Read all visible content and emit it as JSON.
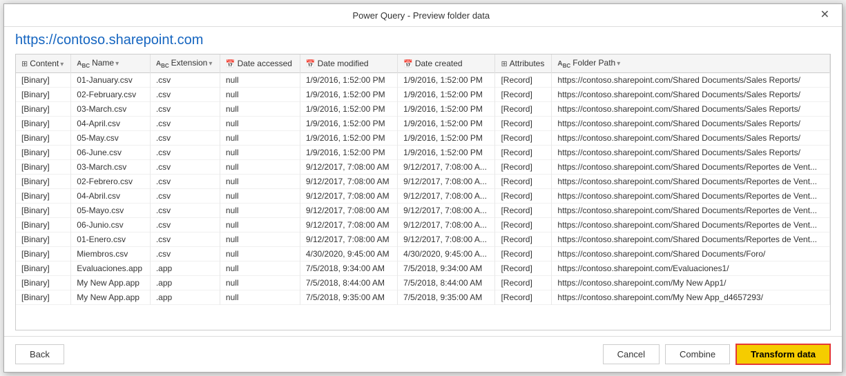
{
  "dialog": {
    "title": "Power Query - Preview folder data",
    "url": "https://contoso.sharepoint.com",
    "close_label": "✕"
  },
  "footer": {
    "back_label": "Back",
    "cancel_label": "Cancel",
    "combine_label": "Combine",
    "transform_label": "Transform data"
  },
  "table": {
    "columns": [
      {
        "id": "content",
        "icon": "≡",
        "filter": true,
        "label": "Content"
      },
      {
        "id": "name",
        "icon": "ABC",
        "filter": true,
        "label": "Name"
      },
      {
        "id": "extension",
        "icon": "ABC",
        "filter": true,
        "label": "Extension"
      },
      {
        "id": "date_accessed",
        "icon": "🗓",
        "filter": false,
        "label": "Date accessed"
      },
      {
        "id": "date_modified",
        "icon": "🗓",
        "filter": false,
        "label": "Date modified"
      },
      {
        "id": "date_created",
        "icon": "🗓",
        "filter": false,
        "label": "Date created"
      },
      {
        "id": "attributes",
        "icon": "≡",
        "filter": false,
        "label": "Attributes"
      },
      {
        "id": "folder_path",
        "icon": "ABC",
        "filter": true,
        "label": "Folder Path"
      }
    ],
    "rows": [
      {
        "content": "[Binary]",
        "name": "01-January.csv",
        "extension": ".csv",
        "date_accessed": "null",
        "date_modified": "1/9/2016, 1:52:00 PM",
        "date_created": "1/9/2016, 1:52:00 PM",
        "attributes": "[Record]",
        "folder_path": "https://contoso.sharepoint.com/Shared Documents/Sales Reports/"
      },
      {
        "content": "[Binary]",
        "name": "02-February.csv",
        "extension": ".csv",
        "date_accessed": "null",
        "date_modified": "1/9/2016, 1:52:00 PM",
        "date_created": "1/9/2016, 1:52:00 PM",
        "attributes": "[Record]",
        "folder_path": "https://contoso.sharepoint.com/Shared Documents/Sales Reports/"
      },
      {
        "content": "[Binary]",
        "name": "03-March.csv",
        "extension": ".csv",
        "date_accessed": "null",
        "date_modified": "1/9/2016, 1:52:00 PM",
        "date_created": "1/9/2016, 1:52:00 PM",
        "attributes": "[Record]",
        "folder_path": "https://contoso.sharepoint.com/Shared Documents/Sales Reports/"
      },
      {
        "content": "[Binary]",
        "name": "04-April.csv",
        "extension": ".csv",
        "date_accessed": "null",
        "date_modified": "1/9/2016, 1:52:00 PM",
        "date_created": "1/9/2016, 1:52:00 PM",
        "attributes": "[Record]",
        "folder_path": "https://contoso.sharepoint.com/Shared Documents/Sales Reports/"
      },
      {
        "content": "[Binary]",
        "name": "05-May.csv",
        "extension": ".csv",
        "date_accessed": "null",
        "date_modified": "1/9/2016, 1:52:00 PM",
        "date_created": "1/9/2016, 1:52:00 PM",
        "attributes": "[Record]",
        "folder_path": "https://contoso.sharepoint.com/Shared Documents/Sales Reports/"
      },
      {
        "content": "[Binary]",
        "name": "06-June.csv",
        "extension": ".csv",
        "date_accessed": "null",
        "date_modified": "1/9/2016, 1:52:00 PM",
        "date_created": "1/9/2016, 1:52:00 PM",
        "attributes": "[Record]",
        "folder_path": "https://contoso.sharepoint.com/Shared Documents/Sales Reports/"
      },
      {
        "content": "[Binary]",
        "name": "03-March.csv",
        "extension": ".csv",
        "date_accessed": "null",
        "date_modified": "9/12/2017, 7:08:00 AM",
        "date_created": "9/12/2017, 7:08:00 A...",
        "attributes": "[Record]",
        "folder_path": "https://contoso.sharepoint.com/Shared Documents/Reportes de Vent..."
      },
      {
        "content": "[Binary]",
        "name": "02-Febrero.csv",
        "extension": ".csv",
        "date_accessed": "null",
        "date_modified": "9/12/2017, 7:08:00 AM",
        "date_created": "9/12/2017, 7:08:00 A...",
        "attributes": "[Record]",
        "folder_path": "https://contoso.sharepoint.com/Shared Documents/Reportes de Vent..."
      },
      {
        "content": "[Binary]",
        "name": "04-Abril.csv",
        "extension": ".csv",
        "date_accessed": "null",
        "date_modified": "9/12/2017, 7:08:00 AM",
        "date_created": "9/12/2017, 7:08:00 A...",
        "attributes": "[Record]",
        "folder_path": "https://contoso.sharepoint.com/Shared Documents/Reportes de Vent..."
      },
      {
        "content": "[Binary]",
        "name": "05-Mayo.csv",
        "extension": ".csv",
        "date_accessed": "null",
        "date_modified": "9/12/2017, 7:08:00 AM",
        "date_created": "9/12/2017, 7:08:00 A...",
        "attributes": "[Record]",
        "folder_path": "https://contoso.sharepoint.com/Shared Documents/Reportes de Vent..."
      },
      {
        "content": "[Binary]",
        "name": "06-Junio.csv",
        "extension": ".csv",
        "date_accessed": "null",
        "date_modified": "9/12/2017, 7:08:00 AM",
        "date_created": "9/12/2017, 7:08:00 A...",
        "attributes": "[Record]",
        "folder_path": "https://contoso.sharepoint.com/Shared Documents/Reportes de Vent..."
      },
      {
        "content": "[Binary]",
        "name": "01-Enero.csv",
        "extension": ".csv",
        "date_accessed": "null",
        "date_modified": "9/12/2017, 7:08:00 AM",
        "date_created": "9/12/2017, 7:08:00 A...",
        "attributes": "[Record]",
        "folder_path": "https://contoso.sharepoint.com/Shared Documents/Reportes de Vent..."
      },
      {
        "content": "[Binary]",
        "name": "Miembros.csv",
        "extension": ".csv",
        "date_accessed": "null",
        "date_modified": "4/30/2020, 9:45:00 AM",
        "date_created": "4/30/2020, 9:45:00 A...",
        "attributes": "[Record]",
        "folder_path": "https://contoso.sharepoint.com/Shared Documents/Foro/"
      },
      {
        "content": "[Binary]",
        "name": "Evaluaciones.app",
        "extension": ".app",
        "date_accessed": "null",
        "date_modified": "7/5/2018, 9:34:00 AM",
        "date_created": "7/5/2018, 9:34:00 AM",
        "attributes": "[Record]",
        "folder_path": "https://contoso.sharepoint.com/Evaluaciones1/"
      },
      {
        "content": "[Binary]",
        "name": "My New App.app",
        "extension": ".app",
        "date_accessed": "null",
        "date_modified": "7/5/2018, 8:44:00 AM",
        "date_created": "7/5/2018, 8:44:00 AM",
        "attributes": "[Record]",
        "folder_path": "https://contoso.sharepoint.com/My New App1/"
      },
      {
        "content": "[Binary]",
        "name": "My New App.app",
        "extension": ".app",
        "date_accessed": "null",
        "date_modified": "7/5/2018, 9:35:00 AM",
        "date_created": "7/5/2018, 9:35:00 AM",
        "attributes": "[Record]",
        "folder_path": "https://contoso.sharepoint.com/My New App_d4657293/"
      }
    ]
  }
}
